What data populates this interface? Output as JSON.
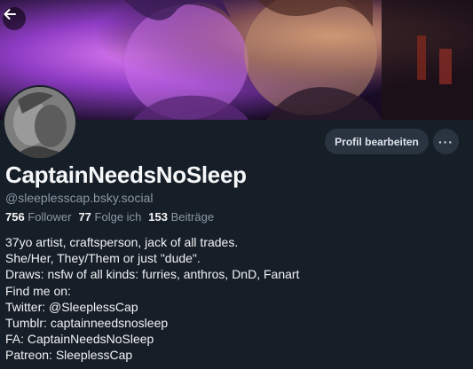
{
  "header": {
    "back_icon": "arrow-left-icon"
  },
  "profile": {
    "display_name": "CaptainNeedsNoSleep",
    "handle": "@sleeplesscap.bsky.social",
    "edit_button": "Profil bearbeiten",
    "more_button": "···"
  },
  "stats": [
    {
      "count": "756",
      "label": "Follower"
    },
    {
      "count": "77",
      "label": "Folge ich"
    },
    {
      "count": "153",
      "label": "Beiträge"
    }
  ],
  "bio": [
    "37yo artist, craftsperson, jack of all trades.",
    "She/Her, They/Them or just \"dude\".",
    "Draws: nsfw of all kinds: furries, anthros, DnD, Fanart",
    "Find me on:",
    "Twitter: @SleeplessCap",
    "Tumblr: captainneedsnosleep",
    "FA: CaptainNeedsNoSleep",
    "Patreon: SleeplessCap"
  ],
  "colors": {
    "background": "#161e27",
    "button_bg": "#2a3441",
    "muted_text": "#8b98a5",
    "banner_accent": "#b04ad8"
  }
}
